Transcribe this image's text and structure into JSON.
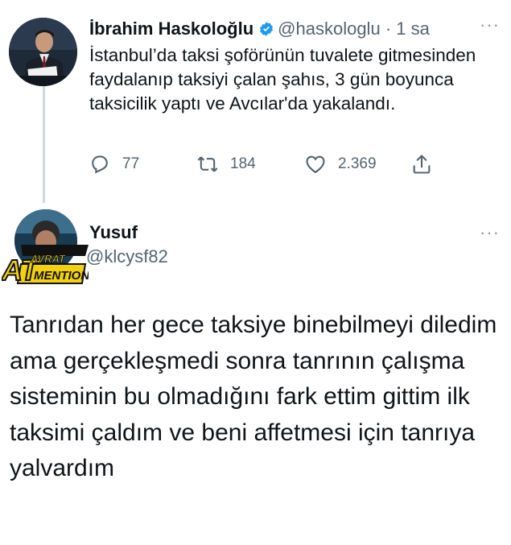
{
  "colors": {
    "verified_blue": "#1d9bf0",
    "secondary_text": "#536471",
    "thread_line": "#cfd9de",
    "badge_black": "#111111",
    "badge_yellow": "#f2d10f"
  },
  "tweet1": {
    "author_name": "İbrahim Haskoloğlu",
    "verified_icon": "verified-badge-icon",
    "handle": "@haskologlu",
    "separator": "·",
    "time": "1 sa",
    "more_icon": "more-dots-icon",
    "more_label": "···",
    "text": "İstanbul’da taksi şoförünün tuvalete gitmesinden faydalanıp taksiyi çalan şahıs, 3 gün boyunca taksicilik yaptı ve Avcılar'da yakalandı.",
    "actions": {
      "reply": {
        "icon": "reply-icon",
        "count": "77"
      },
      "retweet": {
        "icon": "retweet-icon",
        "count": "184"
      },
      "like": {
        "icon": "heart-icon",
        "count": "2.369"
      },
      "share": {
        "icon": "share-icon"
      }
    }
  },
  "tweet2": {
    "author_name": "Yusuf",
    "handle": "@klcysf82",
    "more_label": "···",
    "badge_line1": "AVRAT",
    "badge_line2": "MENTION",
    "badge_prefix": "AT",
    "text": "Tanrıdan her gece taksiye binebilmeyi diledim ama gerçekleşmedi sonra tanrının çalışma sisteminin bu olmadığını fark ettim gittim ilk taksimi çaldım ve beni affetmesi için tanrıya yalvardım"
  }
}
